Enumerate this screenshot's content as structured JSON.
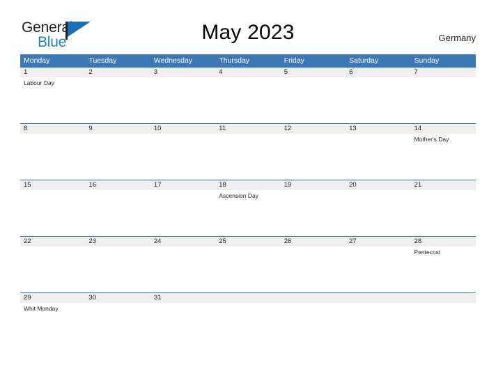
{
  "brand": {
    "word_one": "General",
    "word_two": "Blue",
    "flag_icon": "flag-icon",
    "color_blue": "#1a6fb5",
    "color_dark": "#231f20"
  },
  "header": {
    "title": "May 2023",
    "region": "Germany"
  },
  "theme": {
    "header_blue": "#3a78b8",
    "row_gray": "#efefef",
    "rule_blue": "#2f6ca8",
    "text": "#231f20"
  },
  "calendar": {
    "weekdays": [
      "Monday",
      "Tuesday",
      "Wednesday",
      "Thursday",
      "Friday",
      "Saturday",
      "Sunday"
    ],
    "weeks": [
      {
        "days": [
          {
            "number": "1",
            "event": "Labour Day"
          },
          {
            "number": "2",
            "event": ""
          },
          {
            "number": "3",
            "event": ""
          },
          {
            "number": "4",
            "event": ""
          },
          {
            "number": "5",
            "event": ""
          },
          {
            "number": "6",
            "event": ""
          },
          {
            "number": "7",
            "event": ""
          }
        ]
      },
      {
        "days": [
          {
            "number": "8",
            "event": ""
          },
          {
            "number": "9",
            "event": ""
          },
          {
            "number": "10",
            "event": ""
          },
          {
            "number": "11",
            "event": ""
          },
          {
            "number": "12",
            "event": ""
          },
          {
            "number": "13",
            "event": ""
          },
          {
            "number": "14",
            "event": "Mother's Day"
          }
        ]
      },
      {
        "days": [
          {
            "number": "15",
            "event": ""
          },
          {
            "number": "16",
            "event": ""
          },
          {
            "number": "17",
            "event": ""
          },
          {
            "number": "18",
            "event": "Ascension Day"
          },
          {
            "number": "19",
            "event": ""
          },
          {
            "number": "20",
            "event": ""
          },
          {
            "number": "21",
            "event": ""
          }
        ]
      },
      {
        "days": [
          {
            "number": "22",
            "event": ""
          },
          {
            "number": "23",
            "event": ""
          },
          {
            "number": "24",
            "event": ""
          },
          {
            "number": "25",
            "event": ""
          },
          {
            "number": "26",
            "event": ""
          },
          {
            "number": "27",
            "event": ""
          },
          {
            "number": "28",
            "event": "Pentecost"
          }
        ]
      },
      {
        "days": [
          {
            "number": "29",
            "event": "Whit Monday"
          },
          {
            "number": "30",
            "event": ""
          },
          {
            "number": "31",
            "event": ""
          },
          {
            "number": "",
            "event": ""
          },
          {
            "number": "",
            "event": ""
          },
          {
            "number": "",
            "event": ""
          },
          {
            "number": "",
            "event": ""
          }
        ]
      }
    ]
  }
}
